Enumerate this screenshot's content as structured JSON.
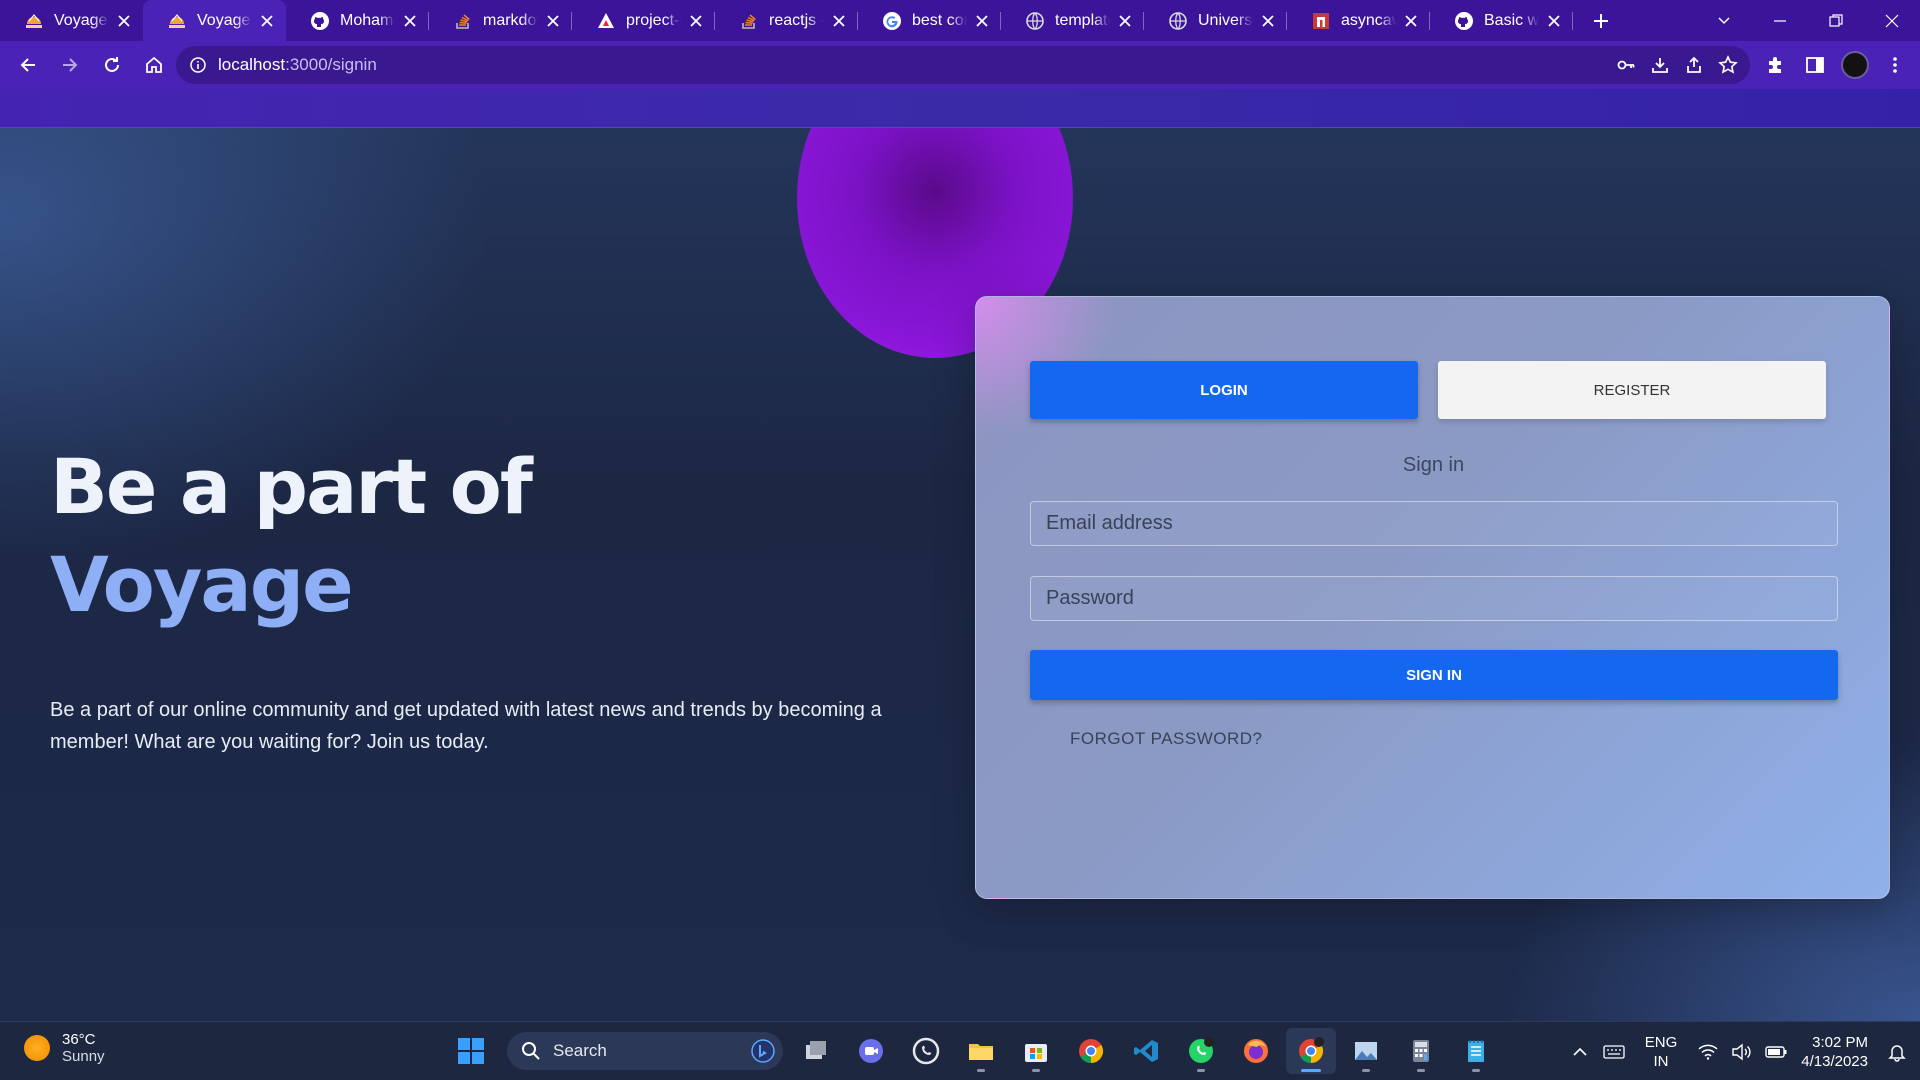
{
  "browser": {
    "tabs": [
      {
        "title": "Voyage",
        "icon": "voyage-favicon",
        "active": false
      },
      {
        "title": "Voyage",
        "icon": "voyage-favicon",
        "active": true
      },
      {
        "title": "Mohamed",
        "icon": "github-icon",
        "active": false
      },
      {
        "title": "markdown",
        "icon": "stackoverflow-icon",
        "active": false
      },
      {
        "title": "project-c",
        "icon": "triangle-icon",
        "active": false
      },
      {
        "title": "reactjs - /",
        "icon": "stackoverflow-icon",
        "active": false
      },
      {
        "title": "best cons",
        "icon": "google-icon",
        "active": false
      },
      {
        "title": "template",
        "icon": "globe-icon",
        "active": false
      },
      {
        "title": "University",
        "icon": "globe-icon",
        "active": false
      },
      {
        "title": "asyncawa",
        "icon": "npm-icon",
        "active": false
      },
      {
        "title": "Basic writ",
        "icon": "github-icon",
        "active": false
      }
    ],
    "url_host": "localhost",
    "url_path": ":3000/signin"
  },
  "hero": {
    "title_line1": "Be a part of",
    "title_line2": "Voyage",
    "description": "Be a part of our online community and get updated with latest news and trends by becoming a member! What are you waiting for? Join us today."
  },
  "auth": {
    "login_tab": "LOGIN",
    "register_tab": "REGISTER",
    "heading": "Sign in",
    "email_placeholder": "Email address",
    "password_placeholder": "Password",
    "signin_button": "SIGN IN",
    "forgot_link": "FORGOT PASSWORD?"
  },
  "taskbar": {
    "temperature": "36°C",
    "condition": "Sunny",
    "search_label": "Search",
    "lang_line1": "ENG",
    "lang_line2": "IN",
    "time": "3:02 PM",
    "date": "4/13/2023"
  },
  "colors": {
    "accent_blue": "#1468f0",
    "chrome_purple": "#4a22b5",
    "orb_purple": "#8a16d8",
    "voyage_accent": "#8eaef5"
  }
}
